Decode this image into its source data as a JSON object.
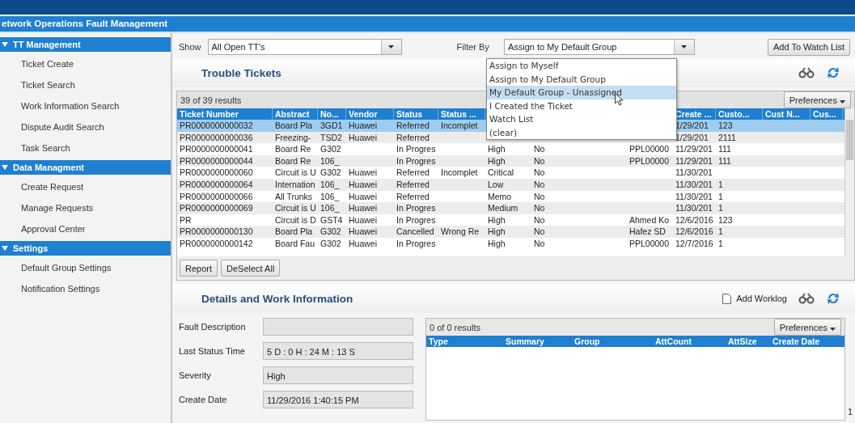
{
  "title": "etwork Operations Fault Management",
  "sidebar": [
    {
      "label": "TT Management",
      "expanded": true,
      "items": [
        "Ticket Create",
        "Ticket Search",
        "Work Information Search",
        "Dispute Audit Search",
        "Task Search"
      ]
    },
    {
      "label": "Data Managment",
      "expanded": true,
      "items": [
        "Create Request",
        "Manage Requests",
        "Approval Center"
      ]
    },
    {
      "label": "Settings",
      "expanded": true,
      "items": [
        "Default Group Settings",
        "Notification Settings"
      ]
    }
  ],
  "toolbar": {
    "show_label": "Show",
    "show_value": "All Open TT's",
    "filter_label": "Filter By",
    "filter_value": "Assign to My Default Group",
    "watch_button": "Add To Watch List",
    "filter_options": [
      {
        "label": "Assign to Myself",
        "selected": false
      },
      {
        "label": "Assign to My Default Group",
        "selected": false
      },
      {
        "label": "My Default Group - Unassigned",
        "selected": true
      },
      {
        "label": "I Created the Ticket",
        "selected": false
      },
      {
        "label": "Watch List",
        "selected": false
      },
      {
        "label": "(clear)",
        "selected": false
      }
    ]
  },
  "tickets": {
    "title": "Trouble Tickets",
    "count": "39 of 39 results",
    "preferences": "Preferences",
    "columns": [
      {
        "label": "Ticket Number"
      },
      {
        "label": "Abstract"
      },
      {
        "label": "No..."
      },
      {
        "label": "Vendor"
      },
      {
        "label": "Status"
      },
      {
        "label": "Status ..."
      },
      {},
      {},
      {},
      {},
      {
        "label": "Create ..."
      },
      {
        "label": "Custo..."
      },
      {
        "label": "Cust N..."
      },
      {
        "label": "Cus..."
      }
    ],
    "rows": [
      {
        "selected": true,
        "cells": [
          "PR0000000000032",
          "Board Pla",
          "3GD1",
          "Huawei",
          "Referred",
          "Incomplet",
          null,
          null,
          null,
          null,
          "1/29/201",
          "123",
          null,
          null
        ]
      },
      {
        "selected": false,
        "cells": [
          "PR0000000000036",
          "Freezing-",
          "TSD2",
          "Huawei",
          "Referred",
          null,
          null,
          null,
          null,
          null,
          "1/29/201",
          "2111",
          null,
          null
        ]
      },
      {
        "selected": false,
        "cells": [
          "PR0000000000041",
          "Board Re",
          "G302",
          null,
          "In Progres",
          null,
          "High",
          "No",
          null,
          "PPL00000",
          "11/29/201",
          "111",
          null,
          null
        ]
      },
      {
        "selected": false,
        "cells": [
          "PR0000000000044",
          "Board Re",
          "106_",
          null,
          "In Progres",
          null,
          "High",
          "No",
          null,
          "PPL00000",
          "11/29/201",
          "111",
          null,
          null
        ]
      },
      {
        "selected": false,
        "cells": [
          "PR0000000000060",
          "Circuit is U",
          "G302",
          "Huawei",
          "Referred",
          "Incomplet",
          "Critical",
          "No",
          null,
          null,
          "11/30/201",
          null,
          null,
          null
        ]
      },
      {
        "selected": false,
        "cells": [
          "PR0000000000064",
          "Internation",
          "106_",
          "Huawei",
          "Referred",
          null,
          "Low",
          "No",
          null,
          null,
          "11/30/201",
          "1",
          null,
          null
        ]
      },
      {
        "selected": false,
        "cells": [
          "PR0000000000066",
          "All Trunks",
          "106_",
          "Huawei",
          "Referred",
          null,
          "Memo",
          "No",
          null,
          null,
          "11/30/201",
          "1",
          null,
          null
        ]
      },
      {
        "selected": false,
        "cells": [
          "PR0000000000069",
          "Circuit is U",
          "106_",
          "Huawei",
          "In Progres",
          null,
          "Medium",
          "No",
          null,
          null,
          "11/30/201",
          "1",
          null,
          null
        ]
      },
      {
        "selected": false,
        "cells": [
          "PR",
          "Circuit is D",
          "GST4",
          "Huawei",
          "In Progres",
          null,
          "High",
          "No",
          null,
          "Ahmed Ko",
          "12/6/2016",
          "123",
          null,
          null
        ]
      },
      {
        "selected": false,
        "cells": [
          "PR0000000000130",
          "Board Pla",
          "G302",
          "Huawei",
          "Cancelled",
          "Wrong Re",
          "High",
          "No",
          null,
          "Hafez SD",
          "12/6/2016",
          "1",
          null,
          null
        ]
      },
      {
        "selected": false,
        "cells": [
          "PR0000000000142",
          "Board Fau",
          "G302",
          "Huawei",
          "In Progres",
          null,
          "High",
          "No",
          null,
          "PPL00000",
          "12/7/2016",
          "1",
          null,
          null
        ]
      }
    ],
    "buttons": [
      "Report",
      "DeSelect All"
    ]
  },
  "details": {
    "title": "Details and Work Information",
    "add_worklog": "Add Worklog",
    "fields": [
      {
        "label": "Fault Description"
      },
      {
        "label": "Last Status Time",
        "value": "5 D : 0 H : 24 M : 13 S"
      },
      {
        "label": "Severity",
        "value": "High"
      },
      {
        "label": "Create Date",
        "value": "11/29/2016 1:40:15 PM"
      }
    ],
    "worklog": {
      "count": "0 of 0 results",
      "preferences": "Preferences",
      "columns": [
        "Type",
        "Summary",
        "Group",
        "AttCount",
        "AttSize",
        "Create Date"
      ],
      "page": "1"
    }
  }
}
